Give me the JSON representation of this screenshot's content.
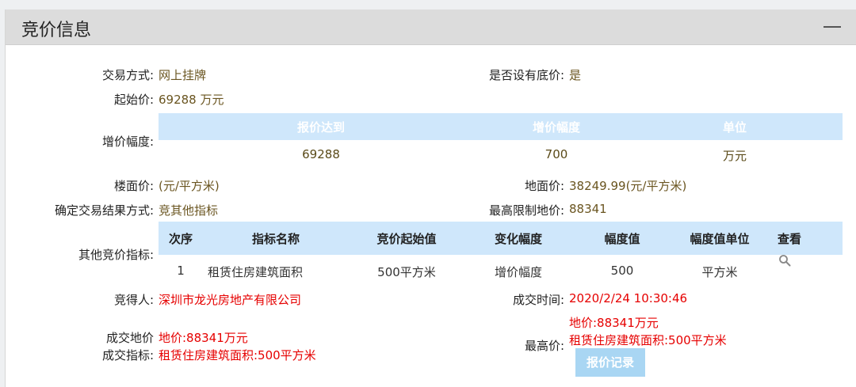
{
  "panel": {
    "title": "竞价信息"
  },
  "fields": {
    "trade_method_label": "交易方式:",
    "trade_method_value": "网上挂牌",
    "reserve_label": "是否设有底价:",
    "reserve_value": "是",
    "start_price_label": "起始价:",
    "start_price_value": "69288 万元",
    "increment_label": "增价幅度:",
    "floor_price_label": "楼面价:",
    "floor_price_value": "(元/平方米)",
    "land_price_label": "地面价:",
    "land_price_value": "38249.99(元/平方米)",
    "result_method_label": "确定交易结果方式:",
    "result_method_value": "竞其他指标",
    "max_land_price_label": "最高限制地价:",
    "max_land_price_value": "88341",
    "other_index_label": "其他竞价指标:",
    "winner_label": "竞得人:",
    "winner_value": "深圳市龙光房地产有限公司",
    "deal_time_label": "成交时间:",
    "deal_time_value": "2020/2/24 10:30:46",
    "deal_land_price_label": "成交地价",
    "deal_land_price_value": "地价:88341万元",
    "deal_index_label": "成交指标:",
    "deal_index_value": "租赁住房建筑面积:500平方米",
    "highest_price_label": "最高价:",
    "highest_price_line1": "地价:88341万元",
    "highest_price_line2": "租赁住房建筑面积:500平方米",
    "bid_record_button": "报价记录"
  },
  "increment_table": {
    "headers": [
      "报价达到",
      "增价幅度",
      "单位"
    ],
    "row": [
      "69288",
      "700",
      "万元"
    ]
  },
  "index_table": {
    "headers": [
      "次序",
      "指标名称",
      "竞价起始值",
      "变化幅度",
      "幅度值",
      "幅度值单位",
      "查看"
    ],
    "row": [
      "1",
      "租赁住房建筑面积",
      "500平方米",
      "增价幅度",
      "500",
      "平方米"
    ]
  },
  "colors": {
    "header_band": "#cfe7fb",
    "value_brown": "#6a5520",
    "highlight_red": "#e60000",
    "button_bg": "#a9d6f3"
  },
  "icons": {
    "view": "search-icon",
    "collapse": "minus-icon"
  }
}
